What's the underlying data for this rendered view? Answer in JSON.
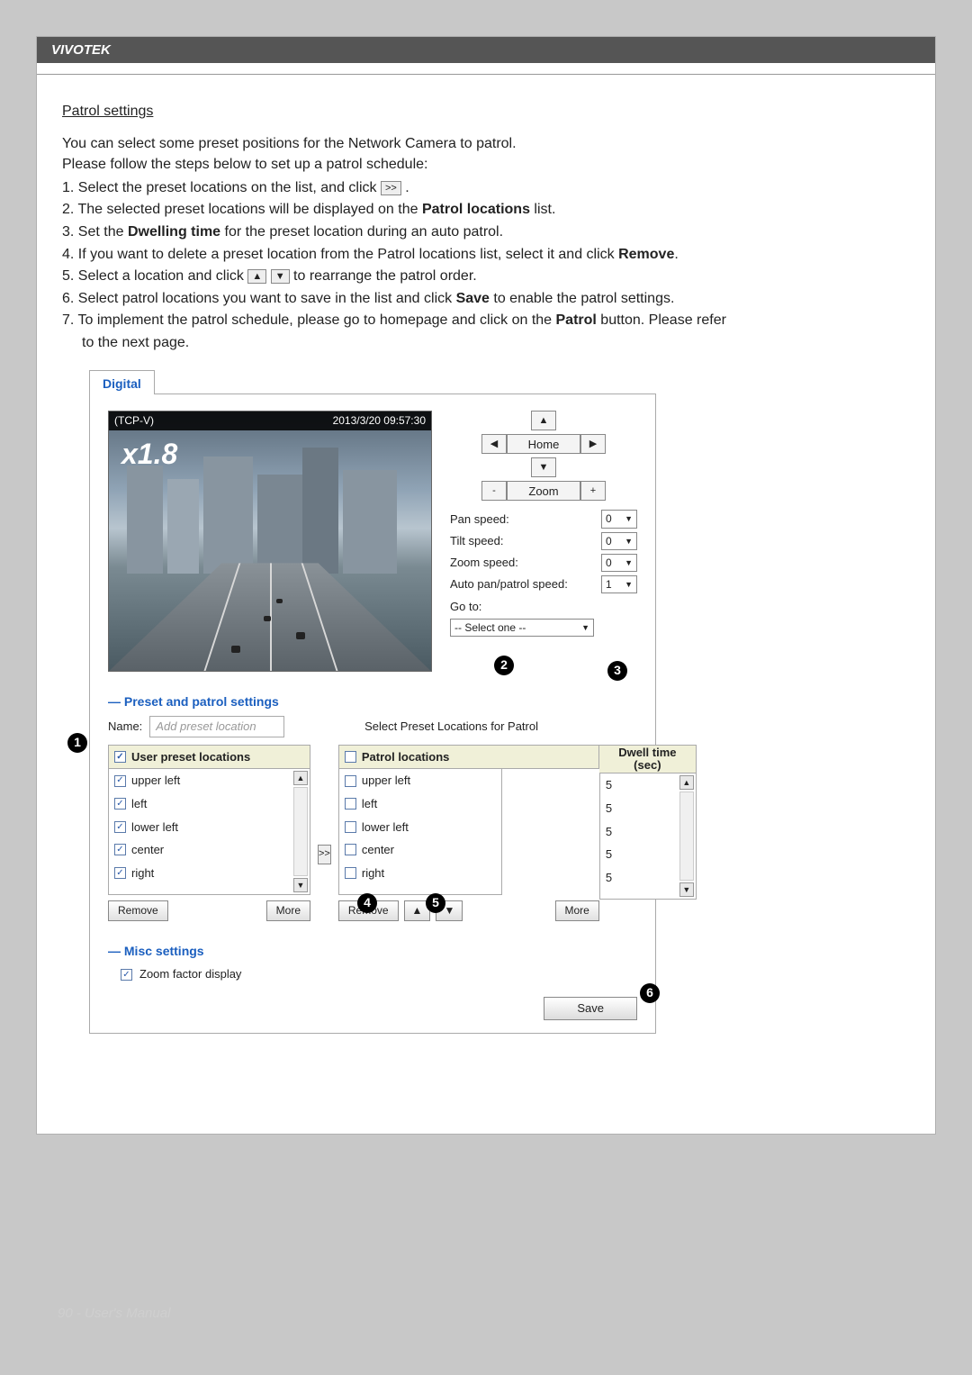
{
  "brand": "VIVOTEK",
  "section_title": "Patrol settings",
  "intro_line1": "You can select some preset positions for the Network Camera to patrol.",
  "intro_line2": "Please follow the steps below to set up a patrol schedule:",
  "steps": {
    "s1a": "1. Select the preset locations on the list, and click ",
    "s1_btn": ">>",
    "s1b": " .",
    "s2a": "2. The selected preset locations will be displayed on the ",
    "s2b": "Patrol locations",
    "s2c": " list.",
    "s3a": "3. Set the ",
    "s3b": "Dwelling time",
    "s3c": " for the preset location during an auto patrol.",
    "s4a": "4. If you want to delete a preset location from the Patrol locations list, select it and click ",
    "s4b": "Remove",
    "s4c": ".",
    "s5a": "5. Select a location and click ",
    "s5_btn1": "▲",
    "s5_btn2": "▼",
    "s5b": " to rearrange the patrol order.",
    "s6a": "6. Select patrol locations you want to save in the list and click ",
    "s6b": "Save",
    "s6c": " to enable the patrol settings.",
    "s7a": "7. To implement the patrol schedule, please go to homepage and click on the ",
    "s7b": "Patrol",
    "s7c": " button. Please refer",
    "s7d": "to the next page."
  },
  "ui": {
    "tab": "Digital",
    "video": {
      "source": "(TCP-V)",
      "timestamp": "2013/3/20 09:57:30",
      "zoom_factor": "x1.8"
    },
    "dpad": {
      "up": "▲",
      "down": "▼",
      "left": "◀",
      "right": "▶",
      "home": "Home",
      "zoom": "Zoom",
      "minus": "-",
      "plus": "+"
    },
    "speeds": {
      "pan_label": "Pan speed:",
      "pan_val": "0",
      "tilt_label": "Tilt speed:",
      "tilt_val": "0",
      "zoom_label": "Zoom speed:",
      "zoom_val": "0",
      "auto_label": "Auto pan/patrol speed:",
      "auto_val": "1",
      "goto_label": "Go to:",
      "goto_val": "-- Select one --"
    },
    "preset_header": "Preset and patrol settings",
    "name_label": "Name:",
    "name_placeholder": "Add preset location",
    "select_label": "Select Preset Locations for Patrol",
    "user_presets_header": "User preset locations",
    "patrol_header": "Patrol locations",
    "dwell_header_l1": "Dwell time",
    "dwell_header_l2": "(sec)",
    "remove_btn": "Remove",
    "more_btn": "More",
    "transfer_btn": ">>",
    "up_btn": "▲",
    "down_btn": "▼",
    "presets": [
      {
        "name": "upper left",
        "checked": true
      },
      {
        "name": "left",
        "checked": true
      },
      {
        "name": "lower left",
        "checked": true
      },
      {
        "name": "center",
        "checked": true
      },
      {
        "name": "right",
        "checked": true
      }
    ],
    "patrols": [
      {
        "name": "upper left",
        "dwell": "5"
      },
      {
        "name": "left",
        "dwell": "5"
      },
      {
        "name": "lower left",
        "dwell": "5"
      },
      {
        "name": "center",
        "dwell": "5"
      },
      {
        "name": "right",
        "dwell": "5"
      }
    ],
    "misc_header": "Misc settings",
    "misc_zoom": "Zoom factor display",
    "save_btn": "Save"
  },
  "callouts": {
    "c1": "1",
    "c2": "2",
    "c3": "3",
    "c4": "4",
    "c5": "5",
    "c6": "6"
  },
  "footer": "90 - User's Manual"
}
